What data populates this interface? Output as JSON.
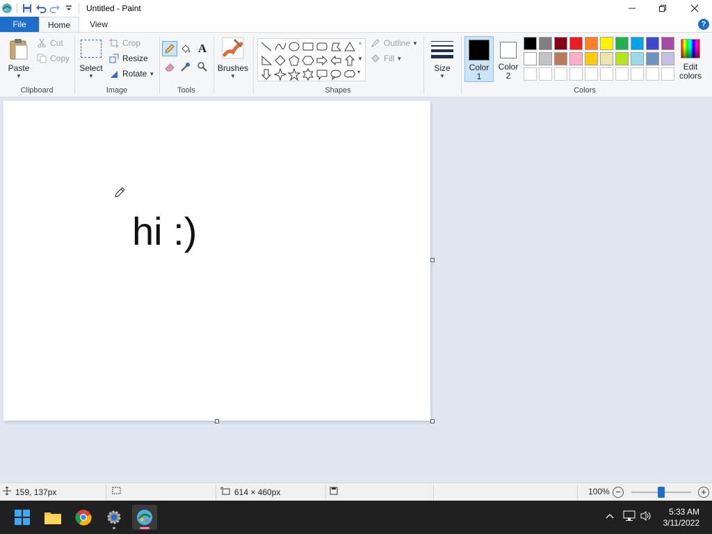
{
  "window": {
    "title": "Untitled - Paint"
  },
  "tabs": [
    {
      "label": "File"
    },
    {
      "label": "Home"
    },
    {
      "label": "View"
    }
  ],
  "help_label": "?",
  "clipboard": {
    "group": "Clipboard",
    "paste": "Paste",
    "cut": "Cut",
    "copy": "Copy"
  },
  "image": {
    "group": "Image",
    "select": "Select",
    "crop": "Crop",
    "resize": "Resize",
    "rotate": "Rotate"
  },
  "tools": {
    "group": "Tools"
  },
  "brushes": {
    "label": "Brushes"
  },
  "shapes": {
    "group": "Shapes",
    "outline": "Outline",
    "fill": "Fill"
  },
  "size": {
    "label": "Size"
  },
  "colors": {
    "group": "Colors",
    "color1_line1": "Color",
    "color1_line2": "1",
    "color2_line1": "Color",
    "color2_line2": "2",
    "edit_line1": "Edit",
    "edit_line2": "colors",
    "color1": "#000000",
    "color2": "#ffffff",
    "palette_row1": [
      "#000000",
      "#7f7f7f",
      "#880015",
      "#ed1c24",
      "#ff7f27",
      "#fff200",
      "#22b14c",
      "#00a2e8",
      "#3f48cc",
      "#a349a4"
    ],
    "palette_row2": [
      "#ffffff",
      "#c3c3c3",
      "#b97a57",
      "#ffaec9",
      "#ffc90e",
      "#efe4b0",
      "#b5e61d",
      "#99d9ea",
      "#7092be",
      "#c8bfe7"
    ]
  },
  "canvas": {
    "text": "hi :)"
  },
  "status": {
    "cursor_pos": "159, 137px",
    "image_size": "614 × 460px",
    "zoom": "100%",
    "zoom_fraction": 0.5
  },
  "clock": {
    "time": "5:33 AM",
    "date": "3/11/2022"
  }
}
